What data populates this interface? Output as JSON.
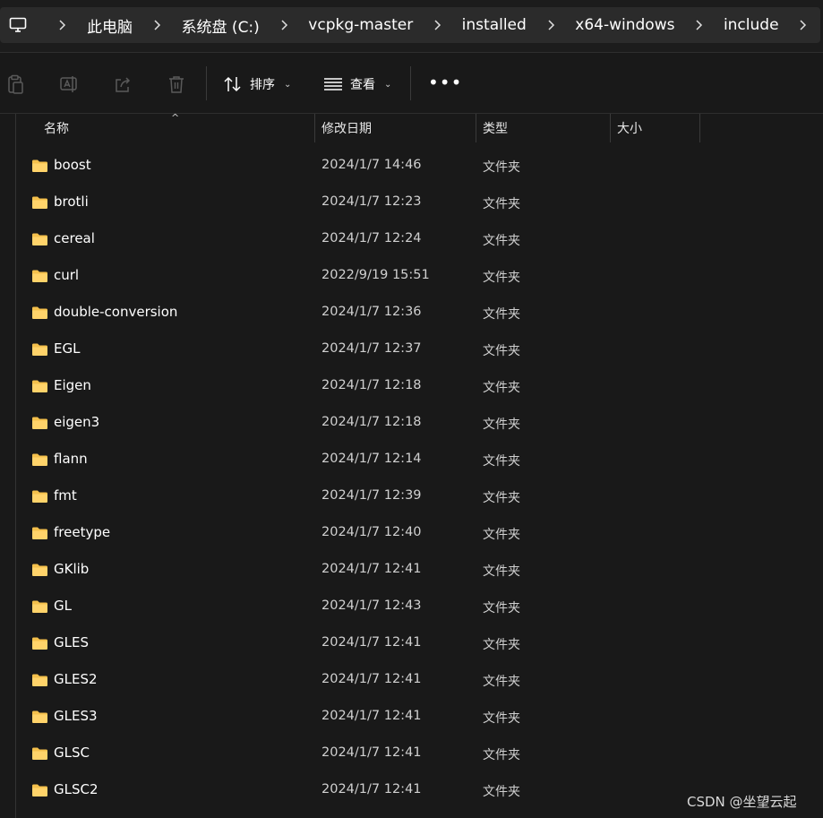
{
  "breadcrumb": [
    "此电脑",
    "系统盘 (C:)",
    "vcpkg-master",
    "installed",
    "x64-windows",
    "include"
  ],
  "toolbar": {
    "icons": [
      "copy-icon",
      "rename-icon",
      "share-icon",
      "delete-icon"
    ],
    "sort_label": "排序",
    "view_label": "查看",
    "more_label": "•••"
  },
  "columns": {
    "name": "名称",
    "modified": "修改日期",
    "type": "类型",
    "size": "大小"
  },
  "rows": [
    {
      "name": "boost",
      "modified": "2024/1/7 14:46",
      "type": "文件夹"
    },
    {
      "name": "brotli",
      "modified": "2024/1/7 12:23",
      "type": "文件夹"
    },
    {
      "name": "cereal",
      "modified": "2024/1/7 12:24",
      "type": "文件夹"
    },
    {
      "name": "curl",
      "modified": "2022/9/19 15:51",
      "type": "文件夹"
    },
    {
      "name": "double-conversion",
      "modified": "2024/1/7 12:36",
      "type": "文件夹"
    },
    {
      "name": "EGL",
      "modified": "2024/1/7 12:37",
      "type": "文件夹"
    },
    {
      "name": "Eigen",
      "modified": "2024/1/7 12:18",
      "type": "文件夹"
    },
    {
      "name": "eigen3",
      "modified": "2024/1/7 12:18",
      "type": "文件夹"
    },
    {
      "name": "flann",
      "modified": "2024/1/7 12:14",
      "type": "文件夹"
    },
    {
      "name": "fmt",
      "modified": "2024/1/7 12:39",
      "type": "文件夹"
    },
    {
      "name": "freetype",
      "modified": "2024/1/7 12:40",
      "type": "文件夹"
    },
    {
      "name": "GKlib",
      "modified": "2024/1/7 12:41",
      "type": "文件夹"
    },
    {
      "name": "GL",
      "modified": "2024/1/7 12:43",
      "type": "文件夹"
    },
    {
      "name": "GLES",
      "modified": "2024/1/7 12:41",
      "type": "文件夹"
    },
    {
      "name": "GLES2",
      "modified": "2024/1/7 12:41",
      "type": "文件夹"
    },
    {
      "name": "GLES3",
      "modified": "2024/1/7 12:41",
      "type": "文件夹"
    },
    {
      "name": "GLSC",
      "modified": "2024/1/7 12:41",
      "type": "文件夹"
    },
    {
      "name": "GLSC2",
      "modified": "2024/1/7 12:41",
      "type": "文件夹"
    }
  ],
  "watermark": "CSDN @坐望云起",
  "colors": {
    "background": "#191919",
    "address_bar": "#2b2b2b",
    "folder": "#f4c04c"
  }
}
